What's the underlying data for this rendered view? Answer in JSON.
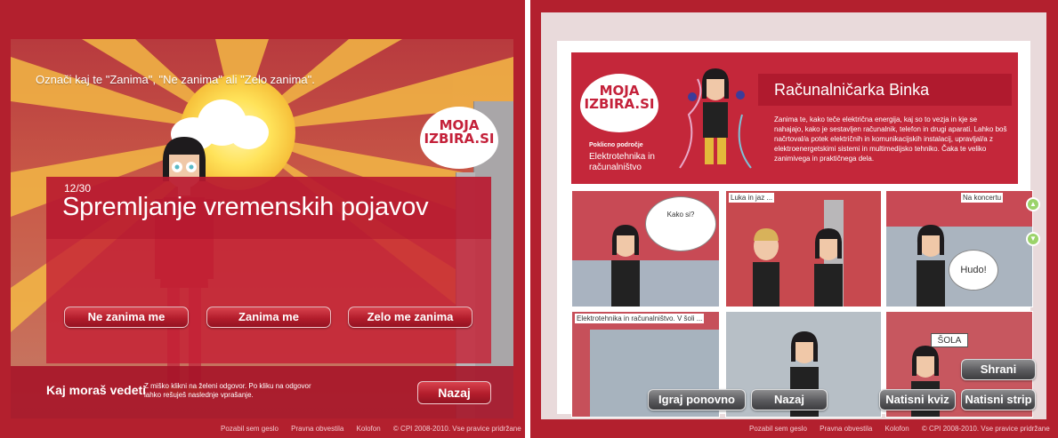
{
  "left": {
    "instruction": "Označi kaj te \"Zanima\", \"Ne zanima\" ali \"Zelo zanima\".",
    "logo": {
      "line1": "MOJA",
      "line2": "IZBIRA.SI"
    },
    "progress": "12/30",
    "question": "Spremljanje vremenskih pojavov",
    "answers": [
      "Ne zanima me",
      "Zanima me",
      "Zelo me zanima"
    ],
    "footer": {
      "heading": "Kaj moraš vedeti",
      "hint": "Z miško klikni na želeni odgovor. Po kliku na odgovor lahko rešuješ naslednje vprašanje.",
      "back_label": "Nazaj"
    },
    "links": [
      "Pozabil sem geslo",
      "Pravna obvestila",
      "Kolofon",
      "© CPI 2008-2010. Vse pravice pridržane"
    ]
  },
  "right": {
    "logo": {
      "line1": "MOJA",
      "line2": "IZBIRA.SI"
    },
    "area_label": "Poklicno področje",
    "area_value": "Elektrotehnika in računalništvo",
    "title": "Računalničarka Binka",
    "description": "Zanima te, kako teče električna energija, kaj so to vezja in kje se nahajajo, kako je sestavljen računalnik, telefon in drugi aparati. Lahko boš načrtoval/a potek električnih in komunikacijskih instalacij, upravljal/a z elektroenergetskimi sistemi in multimedijsko tehniko. Čaka te veliko zanimivega in praktičnega dela.",
    "comic": {
      "speech_1": "Kako si?",
      "caption_2": "Luka in jaz ...",
      "caption_3": "Na koncertu",
      "speech_3": "Hudo!",
      "caption_4": "Elektrotehnika in računalništvo. V šoli ...",
      "sign_6": "ŠOLA"
    },
    "buttons": {
      "save": "Shrani",
      "replay": "Igraj ponovno",
      "back": "Nazaj",
      "print_quiz": "Natisni kviz",
      "print_strip": "Natisni strip"
    },
    "links": [
      "Pozabil sem geslo",
      "Pravna obvestila",
      "Kolofon",
      "© CPI 2008-2010. Vse pravice pridržane"
    ]
  }
}
